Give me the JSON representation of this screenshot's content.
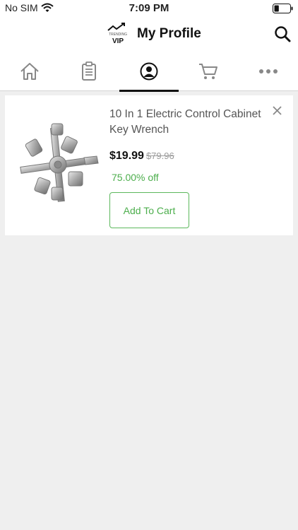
{
  "status_bar": {
    "carrier": "No SIM",
    "time": "7:09 PM",
    "wifi_icon": "wifi-icon",
    "battery_icon": "battery-icon",
    "battery_level": 0.3
  },
  "header": {
    "title": "My Profile",
    "logo_icon": "trending-vip-logo",
    "logo_text_top": "TRENDING",
    "logo_text_bottom": "VIP",
    "search_icon": "search-icon"
  },
  "tabs": [
    {
      "name": "home",
      "icon": "home-icon",
      "active": false
    },
    {
      "name": "orders",
      "icon": "clipboard-icon",
      "active": false
    },
    {
      "name": "profile",
      "icon": "user-circle-icon",
      "active": true
    },
    {
      "name": "cart",
      "icon": "cart-icon",
      "active": false
    },
    {
      "name": "more",
      "icon": "more-dots-icon",
      "active": false
    }
  ],
  "product": {
    "name": "10 In 1 Electric Control Cabinet Key Wrench",
    "price": "$19.99",
    "original_price": "$79.96",
    "discount": "75.00% off",
    "add_to_cart_label": "Add To Cart",
    "remove_icon": "close-icon",
    "image_icon": "key-wrench-image"
  },
  "colors": {
    "accent_green": "#4cae4c",
    "background": "#efefef",
    "active_tab_indicator": "#111111"
  }
}
